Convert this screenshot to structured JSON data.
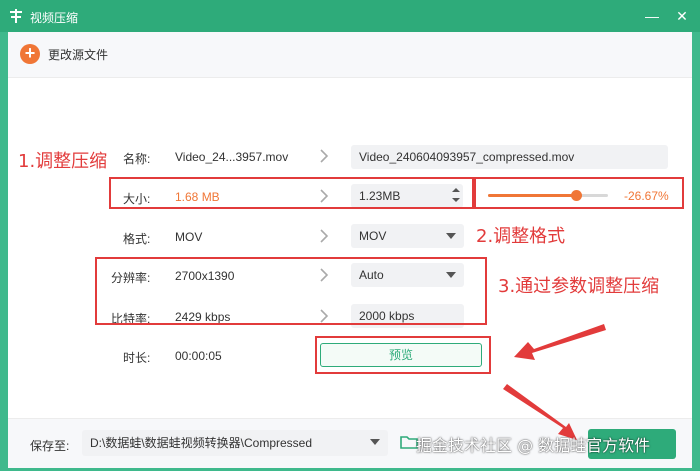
{
  "window": {
    "title": "视频压缩",
    "minimize": "—",
    "close": "✕"
  },
  "toolbar": {
    "change_source_label": "更改源文件"
  },
  "rows": {
    "name": {
      "label": "名称:",
      "source": "Video_24...3957.mov",
      "output": "Video_240604093957_compressed.mov"
    },
    "size": {
      "label": "大小:",
      "source": "1.68 MB",
      "output": "1.23MB",
      "slider_fraction": 0.73,
      "percent": "-26.67%"
    },
    "format": {
      "label": "格式:",
      "source": "MOV",
      "output": "MOV"
    },
    "resolution": {
      "label": "分辨率:",
      "source": "2700x1390",
      "output": "Auto"
    },
    "bitrate": {
      "label": "比特率:",
      "source": "2429 kbps",
      "output": "2000 kbps"
    },
    "duration": {
      "label": "时长:",
      "source": "00:00:05"
    }
  },
  "preview_label": "预览",
  "save": {
    "label": "保存至:",
    "path": "D:\\数据蛙\\数据蛙视频转换器\\Compressed"
  },
  "annotations": {
    "a1": "1.调整压缩",
    "a2": "2.调整格式",
    "a3": "3.通过参数调整压缩"
  },
  "watermark": "掘金技术社区 @ 数据蛙官方软件",
  "colors": {
    "brand_green": "#2eab7a",
    "accent_orange": "#f07636",
    "annotation_red": "#e23b3b"
  },
  "icons": [
    "app-logo-icon",
    "minimize-icon",
    "close-icon",
    "plus-icon",
    "chevron-right-icon",
    "dropdown-arrow-icon",
    "stepper-icon",
    "folder-icon"
  ]
}
